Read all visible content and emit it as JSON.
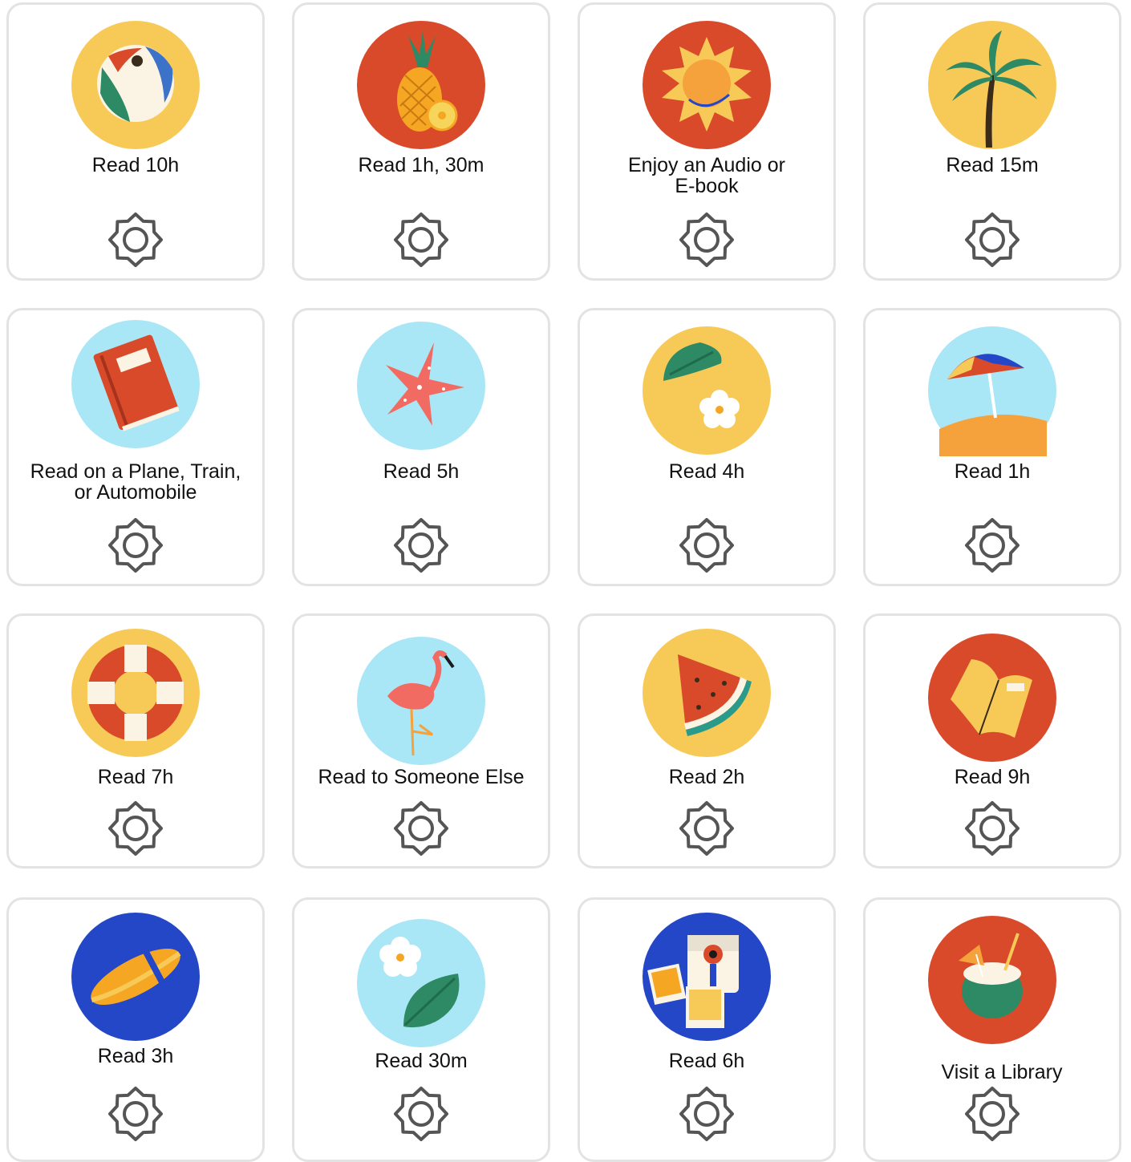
{
  "colors": {
    "yellow": "#f7ca58",
    "red": "#d94a2a",
    "sky": "#a9e6f6",
    "blue": "#2347c6",
    "green": "#2d8a64",
    "gear": "#555555",
    "card_border": "#e3e3e3"
  },
  "gear_icon_name": "settings-gear-icon",
  "badges": [
    {
      "label": "Read 10h",
      "icon": "beach-ball-icon",
      "bg": "yellow"
    },
    {
      "label": "Read 1h, 30m",
      "icon": "pineapple-icon",
      "bg": "red"
    },
    {
      "label": "Enjoy an Audio or E-book",
      "icon": "sun-icon",
      "bg": "red"
    },
    {
      "label": "Read 15m",
      "icon": "palm-tree-icon",
      "bg": "yellow"
    },
    {
      "label": "Read on a Plane, Train, or Automobile",
      "icon": "book-icon",
      "bg": "sky"
    },
    {
      "label": "Read 5h",
      "icon": "starfish-icon",
      "bg": "sky"
    },
    {
      "label": "Read 4h",
      "icon": "monstera-flower-icon",
      "bg": "yellow"
    },
    {
      "label": "Read 1h",
      "icon": "beach-umbrella-icon",
      "bg": "sky"
    },
    {
      "label": "Read 7h",
      "icon": "life-ring-icon",
      "bg": "yellow"
    },
    {
      "label": "Read to Someone Else",
      "icon": "flamingo-icon",
      "bg": "sky"
    },
    {
      "label": "Read 2h",
      "icon": "watermelon-icon",
      "bg": "yellow"
    },
    {
      "label": "Read 9h",
      "icon": "open-book-icon",
      "bg": "red"
    },
    {
      "label": "Read 3h",
      "icon": "surfboard-icon",
      "bg": "blue"
    },
    {
      "label": "Read 30m",
      "icon": "flower-leaf-icon",
      "bg": "sky"
    },
    {
      "label": "Read 6h",
      "icon": "instant-camera-icon",
      "bg": "blue"
    },
    {
      "label": "Visit a Library",
      "icon": "coconut-drink-icon",
      "bg": "red"
    }
  ]
}
